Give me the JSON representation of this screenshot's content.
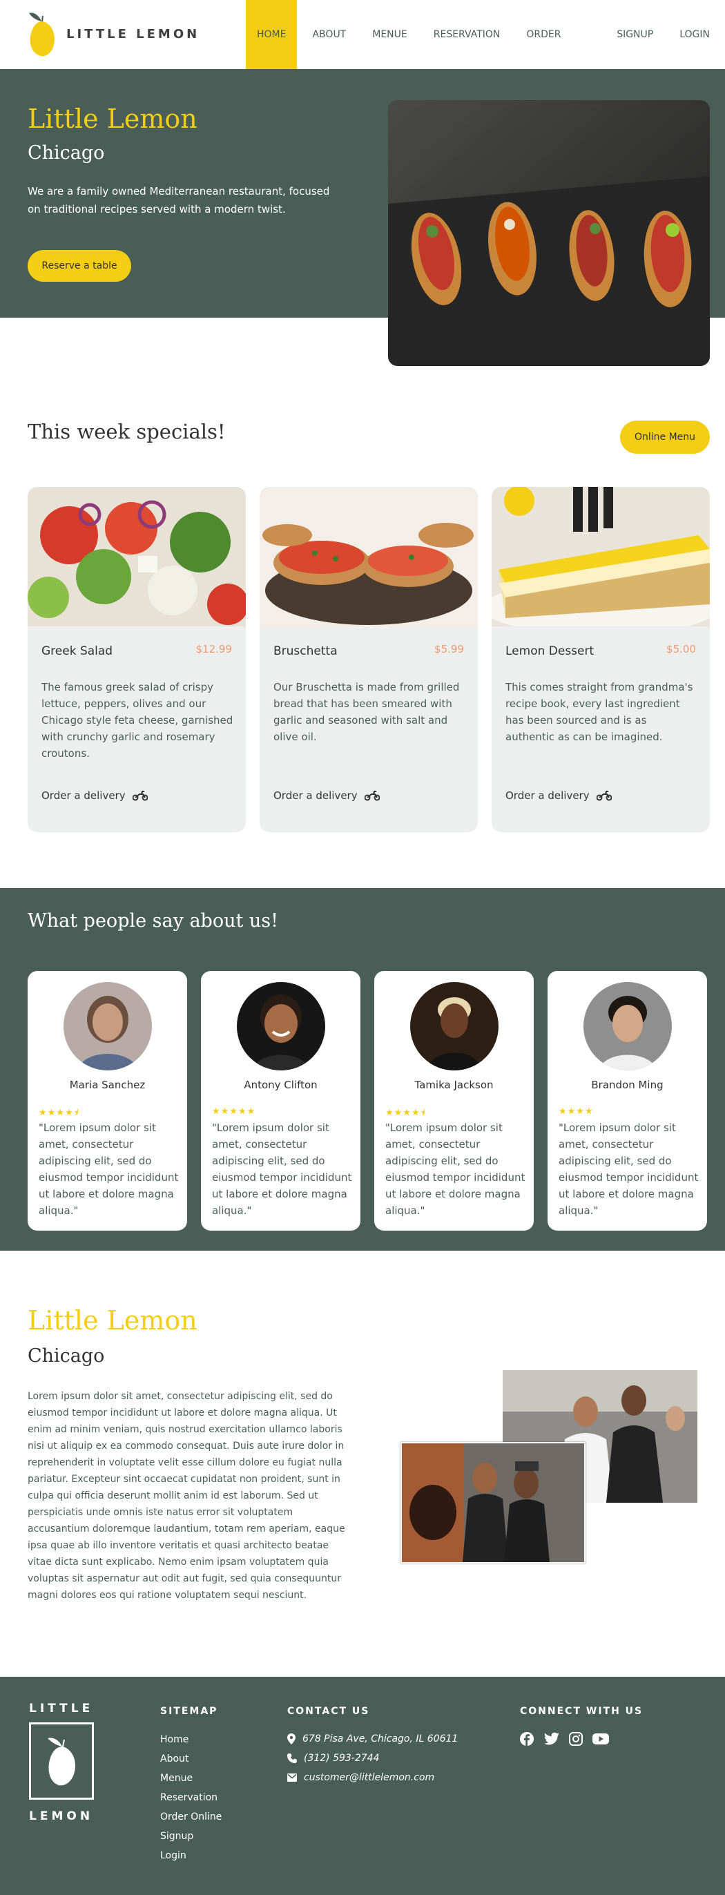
{
  "nav": {
    "brand": "LITTLE LEMON",
    "items": [
      "HOME",
      "ABOUT",
      "MENUE",
      "RESERVATION",
      "ORDER ONLINE",
      "SIGNUP",
      "LOGIN"
    ],
    "active": "HOME"
  },
  "hero": {
    "title": "Little Lemon",
    "city": "Chicago",
    "description": "We are a family owned Mediterranean restaurant, focused on traditional recipes served with a modern twist.",
    "button": "Reserve a table"
  },
  "specials": {
    "title": "This week specials!",
    "button": "Online Menu",
    "items": [
      {
        "name": "Greek Salad",
        "price": "$12.99",
        "description": "The famous greek salad of crispy lettuce, peppers, olives and our Chicago style feta cheese, garnished with crunchy garlic and rosemary croutons.",
        "order": "Order a delivery"
      },
      {
        "name": "Bruschetta",
        "price": "$5.99",
        "description": "Our Bruschetta is made from grilled bread that has been smeared with garlic and seasoned with salt and olive oil.",
        "order": "Order a delivery"
      },
      {
        "name": "Lemon Dessert",
        "price": "$5.00",
        "description": "This comes straight from grandma's recipe book, every last ingredient has been sourced and is as authentic as can be imagined.",
        "order": "Order a delivery"
      }
    ]
  },
  "testimonials": {
    "title": "What people say about us!",
    "items": [
      {
        "name": "Maria Sanchez",
        "rating": 4.5,
        "stars": "★★★★⯨",
        "quote": "\"Lorem ipsum dolor sit amet, consectetur adipiscing elit, sed do eiusmod tempor incididunt ut labore et dolore magna aliqua.\""
      },
      {
        "name": "Antony Clifton",
        "rating": 5,
        "stars": "★★★★★",
        "quote": "\"Lorem ipsum dolor sit amet, consectetur adipiscing elit, sed do eiusmod tempor incididunt ut labore et dolore magna aliqua.\""
      },
      {
        "name": "Tamika Jackson",
        "rating": 4.5,
        "stars": "★★★★⯨",
        "quote": "\"Lorem ipsum dolor sit amet, consectetur adipiscing elit, sed do eiusmod tempor incididunt ut labore et dolore magna aliqua.\""
      },
      {
        "name": "Brandon Ming",
        "rating": 4,
        "stars": "★★★★",
        "quote": "\"Lorem ipsum dolor sit amet, consectetur adipiscing elit, sed do eiusmod tempor incididunt ut labore et dolore magna aliqua.\""
      }
    ]
  },
  "about": {
    "title": "Little Lemon",
    "city": "Chicago",
    "text": "Lorem ipsum dolor sit amet, consectetur adipiscing elit, sed do eiusmod tempor incididunt ut labore et dolore magna aliqua. Ut enim ad minim veniam, quis nostrud exercitation ullamco laboris nisi ut aliquip ex ea commodo consequat. Duis aute irure dolor in reprehenderit in voluptate velit esse cillum dolore eu fugiat nulla pariatur. Excepteur sint occaecat cupidatat non proident, sunt in culpa qui officia deserunt mollit anim id est laborum. Sed ut perspiciatis unde omnis iste natus error sit voluptatem accusantium doloremque laudantium, totam rem aperiam, eaque ipsa quae ab illo inventore veritatis et quasi architecto beatae vitae dicta sunt explicabo. Nemo enim ipsam voluptatem quia voluptas sit aspernatur aut odit aut fugit, sed quia consequuntur magni dolores eos qui ratione voluptatem sequi nesciunt."
  },
  "footer": {
    "logo_top": "LITTLE",
    "logo_bottom": "LEMON",
    "sitemap_heading": "SITEMAP",
    "sitemap": [
      "Home",
      "About",
      "Menue",
      "Reservation",
      "Order Online",
      "Signup",
      "Login"
    ],
    "contact_heading": "CONTACT US",
    "address": "678 Pisa Ave, Chicago, IL 60611",
    "phone": "(312) 593-2744",
    "email": "customer@littlelemon.com",
    "connect_heading": "CONNECT WITH US",
    "social_icons": [
      "facebook-icon",
      "twitter-icon",
      "instagram-icon",
      "youtube-icon"
    ]
  },
  "colors": {
    "primary_green": "#495e57",
    "primary_yellow": "#f4ce14",
    "price": "#ee9972",
    "card_bg": "#edefee"
  }
}
